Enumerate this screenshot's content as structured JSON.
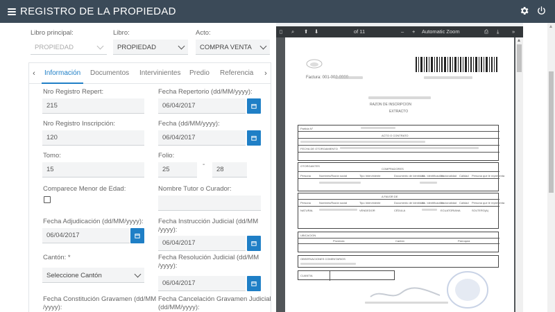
{
  "app": {
    "title": "REGISTRO DE LA PROPIEDAD"
  },
  "filters": {
    "libro_principal": {
      "label": "Libro principal:",
      "value": "PROPIEDAD"
    },
    "libro": {
      "label": "Libro:",
      "value": "PROPIEDAD"
    },
    "acto": {
      "label": "Acto:",
      "value": "COMPRA VENTA"
    }
  },
  "tabs": [
    "Información",
    "Documentos",
    "Intervinientes",
    "Predio",
    "Referencia"
  ],
  "form": {
    "nro_registro_repert": {
      "label": "Nro Registro Repert:",
      "value": "215"
    },
    "fecha_repertorio": {
      "label": "Fecha Repertorio (dd/MM/yyyy):",
      "value": "06/04/2017"
    },
    "nro_registro_inscripcion": {
      "label": "Nro Registro Inscripción:",
      "value": "120"
    },
    "fecha": {
      "label": "Fecha (dd/MM/yyyy):",
      "value": "06/04/2017"
    },
    "tomo": {
      "label": "Tomo:",
      "value": "15"
    },
    "folio": {
      "label": "Folio:",
      "value_from": "25",
      "separator": "-",
      "value_to": "28"
    },
    "comparece_menor": {
      "label": "Comparece Menor de Edad:"
    },
    "nombre_tutor": {
      "label": "Nombre Tutor o Curador:",
      "value": ""
    },
    "fecha_adjudicacion": {
      "label": "Fecha Adjudicación (dd/MM/yyyy):",
      "value": "06/04/2017"
    },
    "fecha_instruccion": {
      "label_1": "Fecha Instrucción Judicial (dd/MM",
      "label_2": "/yyyy):",
      "value": "06/04/2017"
    },
    "canton": {
      "label": "Cantón: *",
      "value": "Seleccione Cantón"
    },
    "fecha_resolucion": {
      "label_1": "Fecha Resolución Judicial (dd/MM",
      "label_2": "/yyyy):",
      "value": "06/04/2017"
    },
    "fecha_constitucion": {
      "label_1": "Fecha Constitución Gravamen (dd/MM",
      "label_2": "/yyyy):"
    },
    "fecha_cancelacion": {
      "label_1": "Fecha Cancelación Gravamen Judicial",
      "label_2": "(dd/MM/yyyy):"
    }
  },
  "pdf_viewer": {
    "page_indicator": "of 11",
    "zoom": "Automatic Zoom",
    "document": {
      "factura": "Factura: 001-002-0000",
      "razon_title": "RAZON DE INSCRIPCION",
      "extracto": "EXTRACTO",
      "cells": {
        "partida": "Partida N°",
        "acto": "ACTO O CONTRATO",
        "fecha_otorgamiento": "FECHA DE OTORGAMIENTO",
        "otorgantes": "OTORGANTES",
        "compradores": "COMPRADORES",
        "vendedores": "A FAVOR DE",
        "ubicacion": "UBICACION",
        "provincia": "Provincia",
        "canton": "Cantón",
        "parroquia": "Parroquia",
        "observaciones": "OBSERVACIONES COMENTARIOS",
        "cuantia": "CUANTIA",
        "persona": "Persona",
        "nombres": "Nombres/Razón social",
        "tipo_interviniente": "Tipo Interviniente",
        "documento": "Documento de Identidad",
        "nro_identificacion": "No. Identificación",
        "nacionalidad": "Nacionalidad",
        "calidad": "Calidad",
        "persona_que_le_representa": "Persona que le representa",
        "cedula": "CÉDULA",
        "soltero": "SOLTERO(A)",
        "vendedor": "VENDEDOR",
        "ecuatoriana": "ECUATORIANA",
        "natural": "NATURAL"
      }
    }
  }
}
